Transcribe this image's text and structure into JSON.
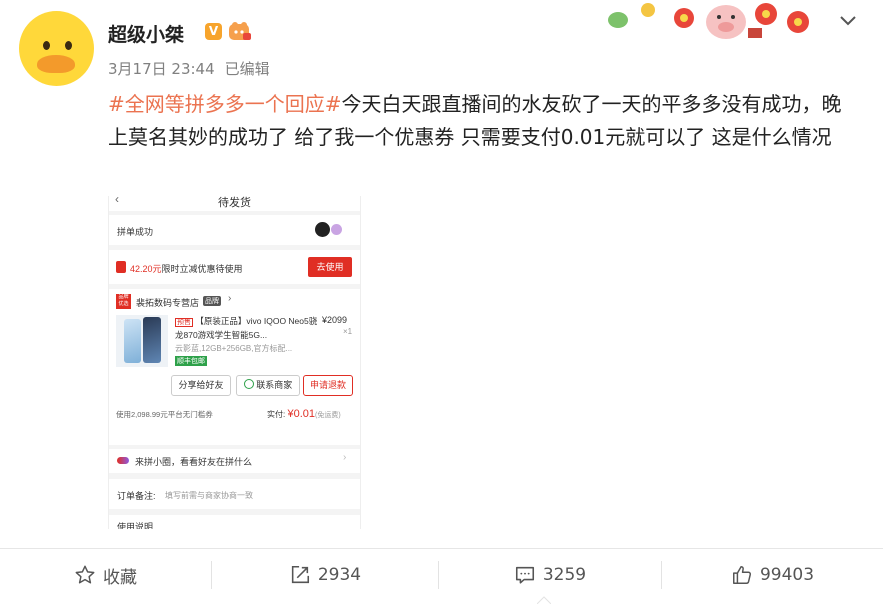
{
  "post": {
    "username": "超级小桀",
    "verified_badge": "V",
    "timestamp": "3月17日 23:44",
    "edited": "已编辑",
    "topic": "#全网等拼多多一个回应#",
    "text": "今天白天跟直播间的水友砍了一天的平多多没有成功，晚上莫名其妙的成功了 给了我一个优惠券 只需要支付0.01元就可以了 这是什么情况"
  },
  "screenshot": {
    "header_title": "待发货",
    "group_status": "拼单成功",
    "coupon_amount": "42.20元",
    "coupon_text": "限时立减优惠待使用",
    "coupon_button": "去使用",
    "store_name": "裴拓数码专营店",
    "store_tag": "品牌",
    "store_logo_text": "品牌\n优选",
    "product_tag": "预售",
    "product_title": "【原装正品】vivo IQOO Neo5骁龙870游戏学生智能5G...",
    "product_price": "¥2099",
    "product_qty": "×1",
    "product_spec": "云影蓝,12GB+256GB,官方标配...",
    "shipping_tag": "顺丰包邮",
    "share_button": "分享给好友",
    "contact_button": "联系商家",
    "refund_button": "申请退款",
    "coupon_used": "使用2,098.99元平台无门槛券",
    "paid_label": "实付:",
    "paid_amount": "¥0.01",
    "paid_note": "(免运费)",
    "circle_text": "来拼小圈，看看好友在拼什么",
    "remark_label": "订单备注:",
    "remark_placeholder": "填写前需与商家协商一致",
    "instructions": "使用说明"
  },
  "footer": {
    "favorite_label": "收藏",
    "repost_count": "2934",
    "comment_count": "3259",
    "like_count": "99403"
  },
  "colors": {
    "topic": "#eb7350",
    "pdd_red": "#e02e24",
    "avatar_yellow": "#ffd83a",
    "badge_orange": "#f7a42c"
  },
  "icons": [
    "duck-avatar-icon",
    "verified-v-icon",
    "level-badge-icon",
    "chevron-down-icon",
    "star-icon",
    "repost-icon",
    "comment-icon",
    "like-icon"
  ]
}
